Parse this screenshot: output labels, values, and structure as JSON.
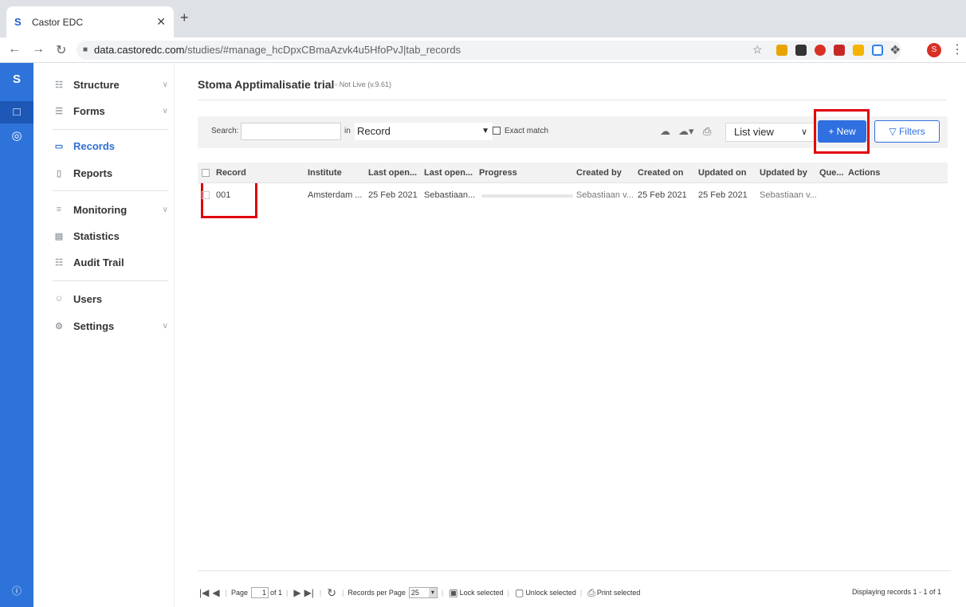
{
  "browser": {
    "tab_title": "Castor EDC",
    "url_host": "data.castoredc.com",
    "url_path": "/studies/#manage_hcDpxCBmaAzvk4u5HfoPvJ|tab_records",
    "profile_initial": "S"
  },
  "sidebar": {
    "items": [
      {
        "label": "Structure",
        "icon": "structure-icon",
        "expandable": true
      },
      {
        "label": "Forms",
        "icon": "forms-icon",
        "expandable": true
      },
      {
        "label": "Records",
        "icon": "records-icon",
        "active": true
      },
      {
        "label": "Reports",
        "icon": "reports-icon"
      },
      {
        "label": "Monitoring",
        "icon": "monitoring-icon",
        "expandable": true
      },
      {
        "label": "Statistics",
        "icon": "statistics-icon"
      },
      {
        "label": "Audit Trail",
        "icon": "audit-trail-icon"
      },
      {
        "label": "Users",
        "icon": "users-icon"
      },
      {
        "label": "Settings",
        "icon": "settings-icon",
        "expandable": true
      }
    ]
  },
  "study": {
    "title": "Stoma Apptimalisatie trial",
    "status": "◦ Not Live (v.9.61)"
  },
  "filterbar": {
    "search_label": "Search:",
    "in_label": "in",
    "field_select": "Record",
    "exact_match_label": "Exact match",
    "view_select": "List view",
    "new_button": "+ New",
    "filters_button": "Filters"
  },
  "table": {
    "columns": [
      "Record",
      "Institute",
      "Last open...",
      "Last open...",
      "Progress",
      "Created by",
      "Created on",
      "Updated on",
      "Updated by",
      "Que...",
      "Actions"
    ],
    "rows": [
      {
        "record": "001",
        "institute": "Amsterdam ...",
        "last_opened_on": "25 Feb 2021",
        "last_opened_by": "Sebastiaan...",
        "progress": 0,
        "created_by": "Sebastiaan v...",
        "created_on": "25 Feb 2021",
        "updated_on": "25 Feb 2021",
        "updated_by": "Sebastiaan v..."
      }
    ]
  },
  "footer": {
    "page_label": "Page",
    "page_value": "1",
    "of_label": "of 1",
    "records_per_page_label": "Records per Page",
    "records_per_page_value": "25",
    "lock_selected": "Lock selected",
    "unlock_selected": "Unlock selected",
    "print_selected": "Print selected",
    "displaying": "Displaying records 1 - 1 of 1"
  },
  "colors": {
    "rail": "#2e73d9",
    "accent": "#2f6fe0",
    "highlight_box": "#e0000b"
  }
}
